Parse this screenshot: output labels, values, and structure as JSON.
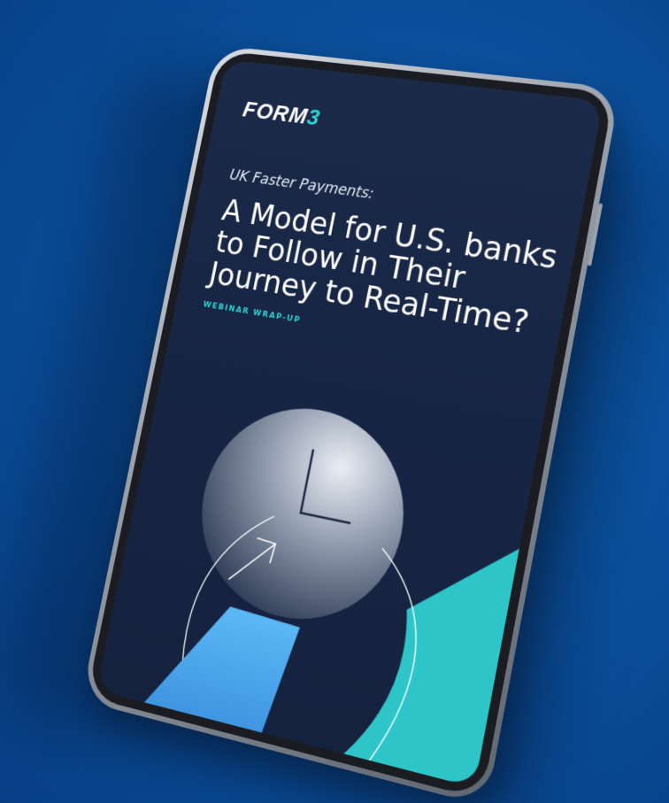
{
  "cover": {
    "brand_prefix": "FORM",
    "brand_suffix": "3",
    "subtitle": "UK Faster Payments:",
    "title_lines": [
      "A Model for U.S. banks",
      "to Follow in Their",
      "Journey to Real-Time?"
    ],
    "tag": "WEBINAR WRAP-UP"
  },
  "colors": {
    "background": "#0a52a0",
    "screen": "#172544",
    "accent_teal": "#2ed3d3",
    "accent_blue": "#4aa8ee"
  },
  "icons": {
    "clock": "clock-icon",
    "arrow": "arrow-icon"
  }
}
